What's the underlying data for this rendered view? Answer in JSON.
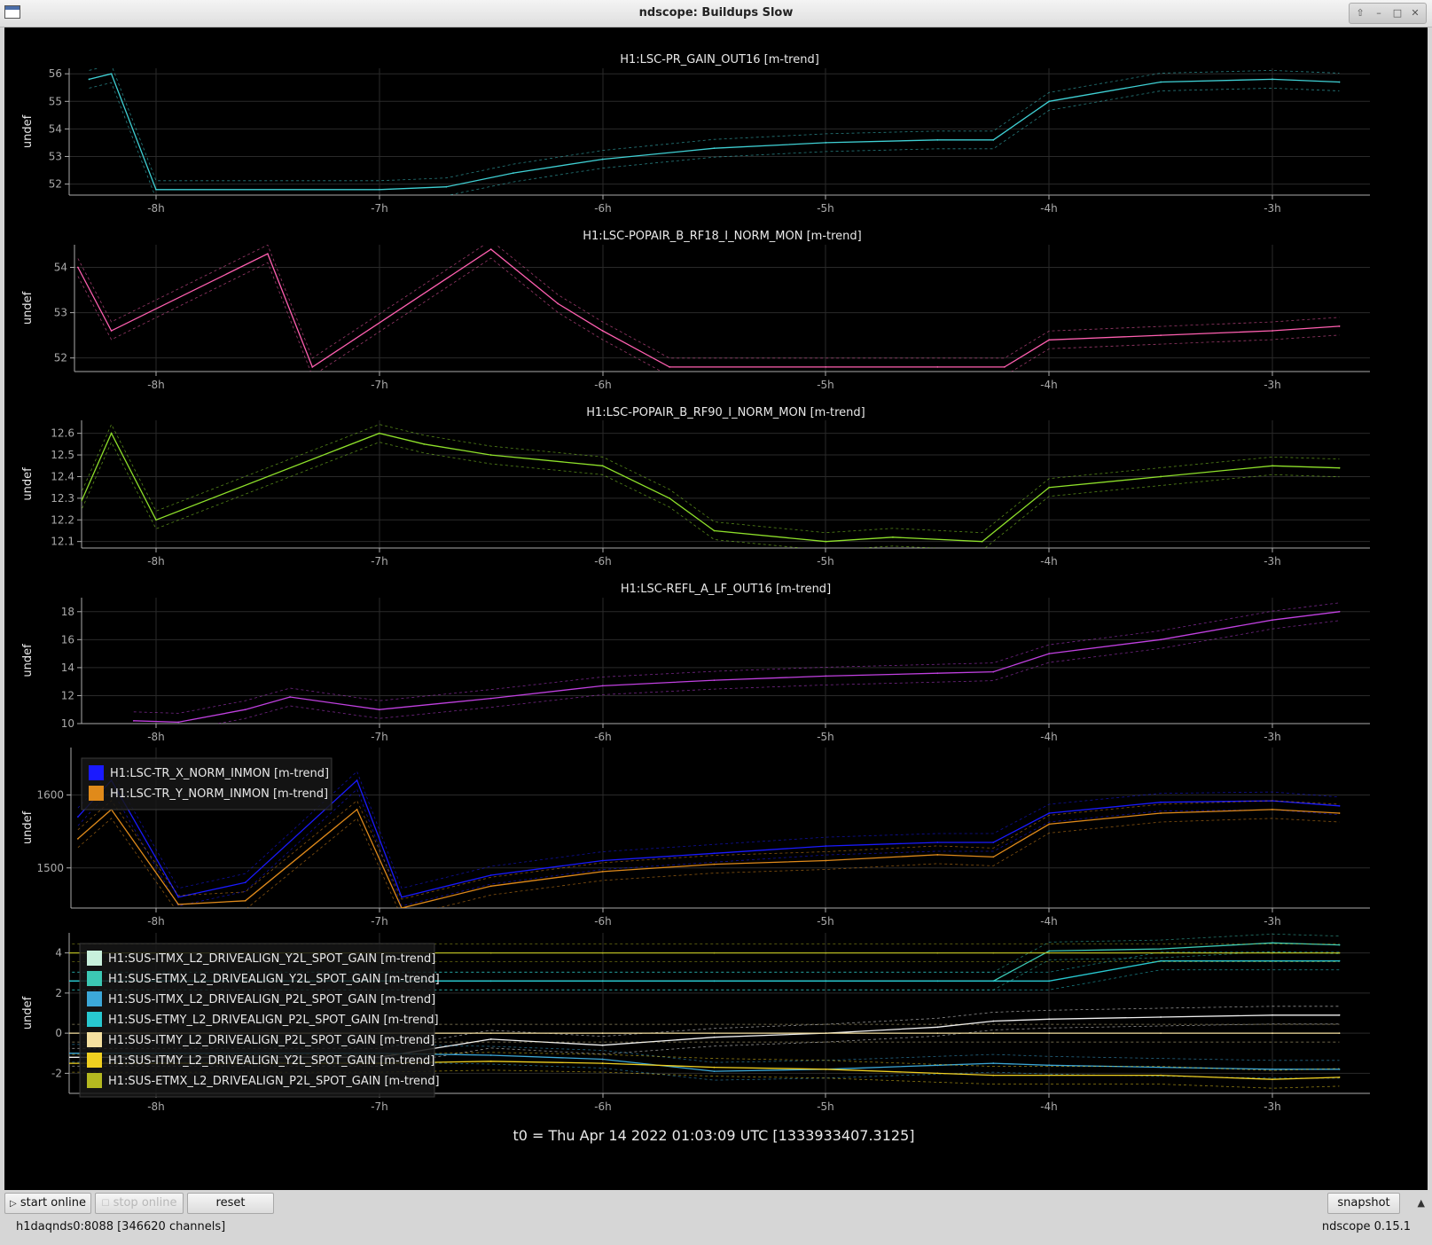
{
  "window": {
    "title": "ndscope: Buildups Slow"
  },
  "panels": [
    {
      "title": "H1:LSC-PR_GAIN_OUT16 [m-trend]",
      "ylabel": "undef",
      "yticks": [
        "52",
        "53",
        "54",
        "55",
        "56"
      ],
      "xticks": [
        "-8h",
        "-7h",
        "-6h",
        "-5h",
        "-4h",
        "-3h"
      ],
      "chart_data": {
        "type": "line",
        "xlabel": "",
        "ylabel": "undef",
        "ylim": [
          51.6,
          56.2
        ],
        "x_hours": [
          -8.3,
          -8.2,
          -8.0,
          -7.0,
          -6.7,
          -6.4,
          -6.0,
          -5.5,
          -5.0,
          -4.5,
          -4.25,
          -4.0,
          -3.5,
          -3.0,
          -2.7
        ],
        "series": [
          {
            "name": "H1:LSC-PR_GAIN_OUT16 [m-trend]",
            "color": "#3fd0d4",
            "values": [
              55.8,
              56.0,
              51.8,
              51.8,
              51.9,
              52.4,
              52.9,
              53.3,
              53.5,
              53.6,
              53.6,
              55.0,
              55.7,
              55.8,
              55.7
            ]
          }
        ]
      }
    },
    {
      "title": "H1:LSC-POPAIR_B_RF18_I_NORM_MON [m-trend]",
      "ylabel": "undef",
      "yticks": [
        "52",
        "53",
        "54"
      ],
      "xticks": [
        "-8h",
        "-7h",
        "-6h",
        "-5h",
        "-4h",
        "-3h"
      ],
      "chart_data": {
        "type": "line",
        "xlabel": "",
        "ylabel": "undef",
        "ylim": [
          51.7,
          54.5
        ],
        "x_hours": [
          -8.35,
          -8.2,
          -7.5,
          -7.3,
          -6.5,
          -6.2,
          -6.0,
          -5.7,
          -5.0,
          -4.5,
          -4.2,
          -4.0,
          -3.5,
          -3.0,
          -2.7
        ],
        "series": [
          {
            "name": "H1:LSC-POPAIR_B_RF18_I_NORM_MON [m-trend]",
            "color": "#ff5fb0",
            "values": [
              54.0,
              52.6,
              54.3,
              51.8,
              54.4,
              53.2,
              52.6,
              51.8,
              51.8,
              51.8,
              51.8,
              52.4,
              52.5,
              52.6,
              52.7
            ]
          }
        ]
      }
    },
    {
      "title": "H1:LSC-POPAIR_B_RF90_I_NORM_MON [m-trend]",
      "ylabel": "undef",
      "yticks": [
        "12.1",
        "12.2",
        "12.3",
        "12.4",
        "12.5",
        "12.6"
      ],
      "xticks": [
        "-8h",
        "-7h",
        "-6h",
        "-5h",
        "-4h",
        "-3h"
      ],
      "chart_data": {
        "type": "line",
        "xlabel": "",
        "ylabel": "undef",
        "ylim": [
          12.07,
          12.66
        ],
        "x_hours": [
          -8.35,
          -8.2,
          -8.0,
          -7.0,
          -6.8,
          -6.5,
          -6.0,
          -5.7,
          -5.5,
          -5.0,
          -4.7,
          -4.3,
          -4.0,
          -3.5,
          -3.0,
          -2.7
        ],
        "series": [
          {
            "name": "H1:LSC-POPAIR_B_RF90_I_NORM_MON [m-trend]",
            "color": "#8ee02a",
            "values": [
              12.25,
              12.6,
              12.2,
              12.6,
              12.55,
              12.5,
              12.45,
              12.3,
              12.15,
              12.1,
              12.12,
              12.1,
              12.35,
              12.4,
              12.45,
              12.44
            ]
          }
        ]
      }
    },
    {
      "title": "H1:LSC-REFL_A_LF_OUT16 [m-trend]",
      "ylabel": "undef",
      "yticks": [
        "10",
        "12",
        "14",
        "16",
        "18"
      ],
      "xticks": [
        "-8h",
        "-7h",
        "-6h",
        "-5h",
        "-4h",
        "-3h"
      ],
      "chart_data": {
        "type": "line",
        "xlabel": "",
        "ylabel": "undef",
        "ylim": [
          10,
          19
        ],
        "x_hours": [
          -8.1,
          -7.9,
          -7.6,
          -7.4,
          -7.0,
          -6.5,
          -6.0,
          -5.5,
          -5.0,
          -4.5,
          -4.25,
          -4.0,
          -3.5,
          -3.0,
          -2.7
        ],
        "series": [
          {
            "name": "H1:LSC-REFL_A_LF_OUT16 [m-trend]",
            "color": "#c040e0",
            "values": [
              10.2,
              10.1,
              11.0,
              11.9,
              11.0,
              11.8,
              12.7,
              13.1,
              13.4,
              13.6,
              13.7,
              15.0,
              16.0,
              17.4,
              18.0
            ]
          }
        ]
      }
    },
    {
      "title": "",
      "ylabel": "undef",
      "yticks": [
        "1500",
        "1600"
      ],
      "xticks": [
        "-8h",
        "-7h",
        "-6h",
        "-5h",
        "-4h",
        "-3h"
      ],
      "legend": [
        {
          "label": "H1:LSC-TR_X_NORM_INMON [m-trend]",
          "color": "#1a1aff"
        },
        {
          "label": "H1:LSC-TR_Y_NORM_INMON [m-trend]",
          "color": "#e08a1a"
        }
      ],
      "chart_data": {
        "type": "line",
        "xlabel": "",
        "ylabel": "undef",
        "ylim": [
          1445,
          1665
        ],
        "legend": "top-left",
        "x_hours": [
          -8.35,
          -8.2,
          -7.9,
          -7.6,
          -7.1,
          -6.9,
          -6.5,
          -6.0,
          -5.5,
          -5.0,
          -4.5,
          -4.25,
          -4.0,
          -3.5,
          -3.0,
          -2.7
        ],
        "series": [
          {
            "name": "H1:LSC-TR_X_NORM_INMON [m-trend]",
            "color": "#1a1aff",
            "values": [
              1570,
              1620,
              1460,
              1480,
              1620,
              1460,
              1490,
              1510,
              1520,
              1530,
              1535,
              1535,
              1575,
              1590,
              1592,
              1585
            ]
          },
          {
            "name": "H1:LSC-TR_Y_NORM_INMON [m-trend]",
            "color": "#e08a1a",
            "values": [
              1540,
              1580,
              1450,
              1455,
              1580,
              1445,
              1475,
              1495,
              1505,
              1510,
              1518,
              1515,
              1560,
              1575,
              1580,
              1575
            ]
          }
        ]
      }
    },
    {
      "title": "",
      "ylabel": "undef",
      "yticks": [
        "-2",
        "0",
        "2",
        "4"
      ],
      "xticks": [
        "-8h",
        "-7h",
        "-6h",
        "-5h",
        "-4h",
        "-3h"
      ],
      "legend": [
        {
          "label": "H1:SUS-ITMX_L2_DRIVEALIGN_Y2L_SPOT_GAIN [m-trend]",
          "color": "#c8f0dc"
        },
        {
          "label": "H1:SUS-ETMX_L2_DRIVEALIGN_Y2L_SPOT_GAIN [m-trend]",
          "color": "#3cc8b4"
        },
        {
          "label": "H1:SUS-ITMX_L2_DRIVEALIGN_P2L_SPOT_GAIN [m-trend]",
          "color": "#3ca8d8"
        },
        {
          "label": "H1:SUS-ETMY_L2_DRIVEALIGN_P2L_SPOT_GAIN [m-trend]",
          "color": "#28c8d0"
        },
        {
          "label": "H1:SUS-ITMY_L2_DRIVEALIGN_P2L_SPOT_GAIN [m-trend]",
          "color": "#f4e0a0"
        },
        {
          "label": "H1:SUS-ITMY_L2_DRIVEALIGN_Y2L_SPOT_GAIN [m-trend]",
          "color": "#f0d020"
        },
        {
          "label": "H1:SUS-ETMX_L2_DRIVEALIGN_P2L_SPOT_GAIN [m-trend]",
          "color": "#b4b820"
        }
      ],
      "chart_data": {
        "type": "line",
        "xlabel": "",
        "ylabel": "undef",
        "ylim": [
          -3,
          5
        ],
        "legend": "top-left",
        "x_hours": [
          -8.4,
          -7.0,
          -6.5,
          -6.0,
          -5.5,
          -5.0,
          -4.5,
          -4.25,
          -4.0,
          -3.5,
          -3.0,
          -2.7
        ],
        "series": [
          {
            "name": "H1:SUS-ITMX_L2_DRIVEALIGN_Y2L_SPOT_GAIN [m-trend]",
            "color": "#f0f0f0",
            "values": [
              -1.2,
              -1.2,
              -0.3,
              -0.6,
              -0.2,
              0.0,
              0.3,
              0.6,
              0.7,
              0.8,
              0.9,
              0.9
            ]
          },
          {
            "name": "H1:SUS-ETMX_L2_DRIVEALIGN_Y2L_SPOT_GAIN [m-trend]",
            "color": "#3cc8b4",
            "values": [
              2.6,
              2.6,
              2.6,
              2.6,
              2.6,
              2.6,
              2.6,
              2.6,
              4.1,
              4.2,
              4.5,
              4.4
            ]
          },
          {
            "name": "H1:SUS-ITMX_L2_DRIVEALIGN_P2L_SPOT_GAIN [m-trend]",
            "color": "#3ca8d8",
            "values": [
              -1.0,
              -1.0,
              -1.1,
              -1.3,
              -1.9,
              -1.8,
              -1.6,
              -1.5,
              -1.6,
              -1.7,
              -1.8,
              -1.8
            ]
          },
          {
            "name": "H1:SUS-ETMY_L2_DRIVEALIGN_P2L_SPOT_GAIN [m-trend]",
            "color": "#28c8d0",
            "values": [
              2.6,
              2.6,
              2.6,
              2.6,
              2.6,
              2.6,
              2.6,
              2.6,
              2.6,
              3.6,
              3.6,
              3.6
            ]
          },
          {
            "name": "H1:SUS-ITMY_L2_DRIVEALIGN_P2L_SPOT_GAIN [m-trend]",
            "color": "#f4e0a0",
            "values": [
              0.0,
              0.0,
              0.0,
              0.0,
              0.0,
              0.0,
              0.0,
              0.0,
              0.0,
              0.0,
              0.0,
              0.0
            ]
          },
          {
            "name": "H1:SUS-ITMY_L2_DRIVEALIGN_Y2L_SPOT_GAIN [m-trend]",
            "color": "#f0d020",
            "values": [
              -1.5,
              -1.5,
              -1.4,
              -1.5,
              -1.7,
              -1.8,
              -2.0,
              -2.1,
              -2.1,
              -2.1,
              -2.3,
              -2.2
            ]
          },
          {
            "name": "H1:SUS-ETMX_L2_DRIVEALIGN_P2L_SPOT_GAIN [m-trend]",
            "color": "#b4b820",
            "values": [
              4.0,
              4.0,
              4.0,
              4.0,
              4.0,
              4.0,
              4.0,
              4.0,
              4.0,
              4.0,
              4.0,
              4.0
            ]
          }
        ]
      }
    }
  ],
  "footer": {
    "t0": "t0 = Thu Apr 14 2022 01:03:09 UTC [1333933407.3125]"
  },
  "toolbar": {
    "start_online": "start online",
    "stop_online": "stop online",
    "reset": "reset",
    "snapshot": "snapshot"
  },
  "status": {
    "server": "h1daqnds0:8088  [346620 channels]",
    "version": "ndscope 0.15.1"
  },
  "colors": {
    "background": "#000000",
    "grid": "#2a2a2a",
    "axis": "#aaaaaa",
    "text": "#e8e8e8"
  }
}
